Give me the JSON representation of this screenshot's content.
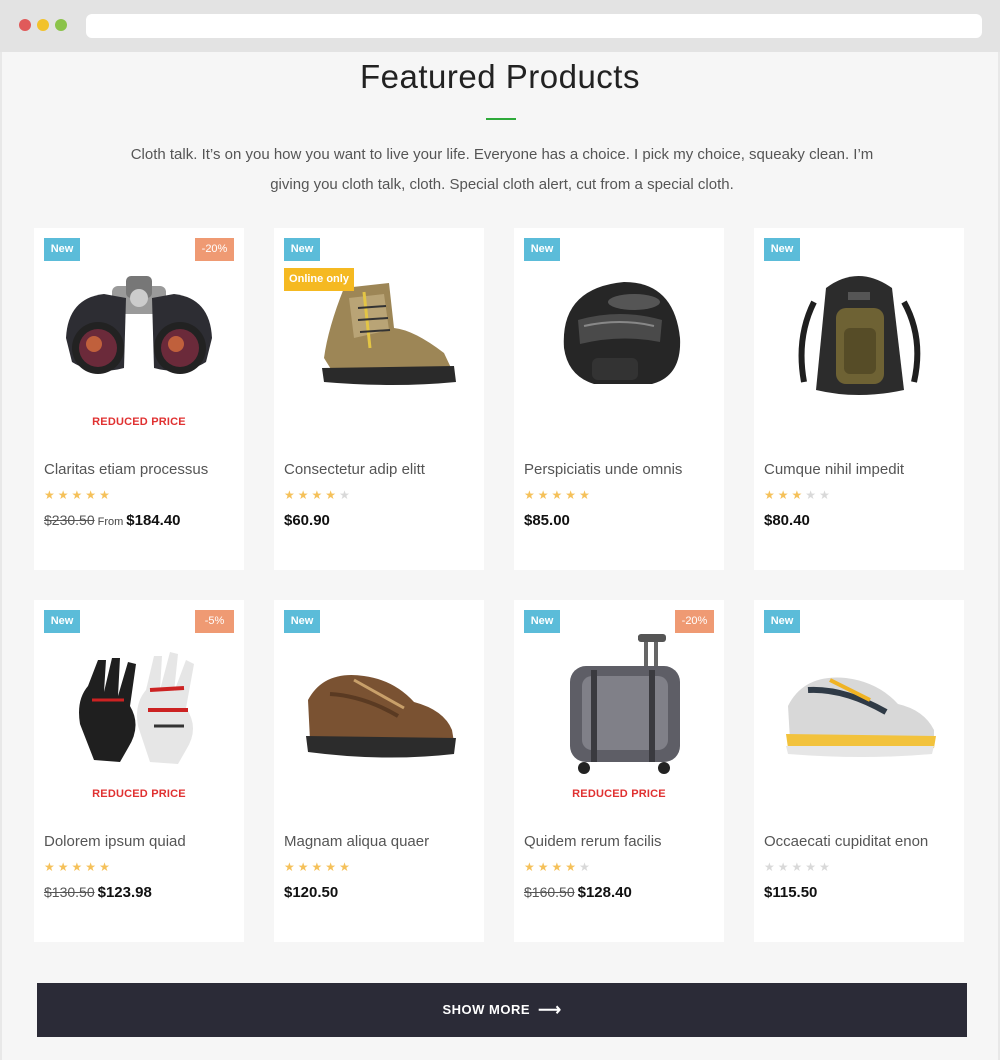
{
  "section": {
    "title": "Featured Products",
    "description": "Cloth talk. It’s on you how you want to live your life. Everyone has a choice. I pick my choice, squeaky clean. I’m giving you cloth talk, cloth. Special cloth alert, cut from a special cloth."
  },
  "products": [
    {
      "name": "Claritas etiam processus",
      "badge": "New",
      "discount": "-20%",
      "label": "REDUCED PRICE",
      "rating": 5,
      "old_price": "$230.50",
      "from": "From",
      "price": "$184.40",
      "image": "binoculars"
    },
    {
      "name": "Consectetur adip elitt",
      "badge": "New",
      "online": "Online only",
      "rating": 4,
      "price": "$60.90",
      "image": "hiking-boot"
    },
    {
      "name": "Perspiciatis unde omnis",
      "badge": "New",
      "rating": 5,
      "price": "$85.00",
      "image": "helmet"
    },
    {
      "name": "Cumque nihil impedit",
      "badge": "New",
      "rating": 3,
      "price": "$80.40",
      "image": "backpack"
    },
    {
      "name": "Dolorem ipsum quiad",
      "badge": "New",
      "discount": "-5%",
      "label": "REDUCED PRICE",
      "rating": 5,
      "old_price": "$130.50",
      "price": "$123.98",
      "image": "gloves"
    },
    {
      "name": "Magnam aliqua quaer",
      "badge": "New",
      "rating": 5,
      "price": "$120.50",
      "image": "shoe-brown"
    },
    {
      "name": "Quidem rerum facilis",
      "badge": "New",
      "discount": "-20%",
      "label": "REDUCED PRICE",
      "rating": 4,
      "old_price": "$160.50",
      "price": "$128.40",
      "image": "luggage"
    },
    {
      "name": "Occaecati cupiditat enon",
      "badge": "New",
      "rating": 0,
      "price": "$115.50",
      "image": "sneaker"
    }
  ],
  "show_more": {
    "label": "SHOW MORE"
  },
  "colors": {
    "accent": "#2eaa3a",
    "badge_new": "#5bbcd9",
    "badge_discount": "#ef9a73",
    "badge_online": "#f5b921",
    "reduced": "#e03131",
    "star": "#f5c15a",
    "button_bg": "#2b2b37"
  }
}
